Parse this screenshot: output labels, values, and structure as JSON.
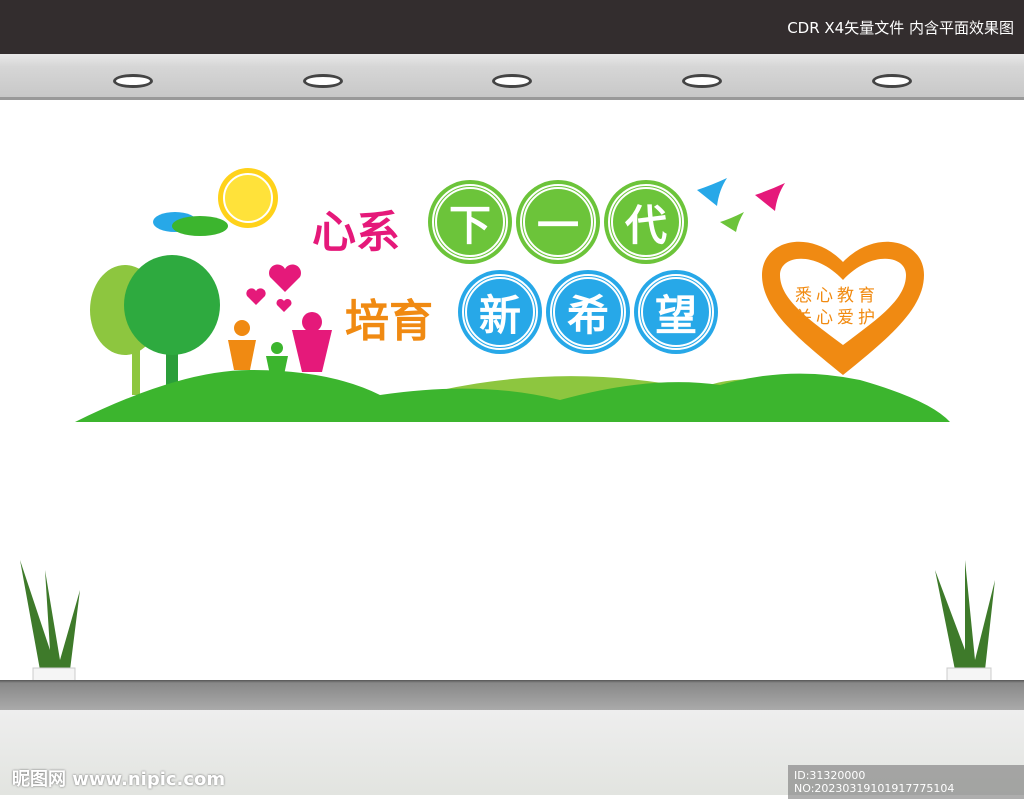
{
  "header": {
    "title": "CDR X4矢量文件  内含平面效果图"
  },
  "slogan": {
    "line1_prefix": "心系",
    "line1_chars": [
      "下",
      "一",
      "代"
    ],
    "line2_prefix": "培育",
    "line2_chars": [
      "新",
      "希",
      "望"
    ]
  },
  "heart": {
    "line1": "悉心教育",
    "line2": "关心爱护"
  },
  "watermark": {
    "site": "昵图网 www.nipic.com",
    "id": "ID:31320000 NO:20230319101917775104"
  },
  "colors": {
    "pink": "#e5197a",
    "orange": "#f08a12",
    "green": "#6cc43a",
    "blue": "#27a8e8",
    "hill": "#3cb52e"
  }
}
